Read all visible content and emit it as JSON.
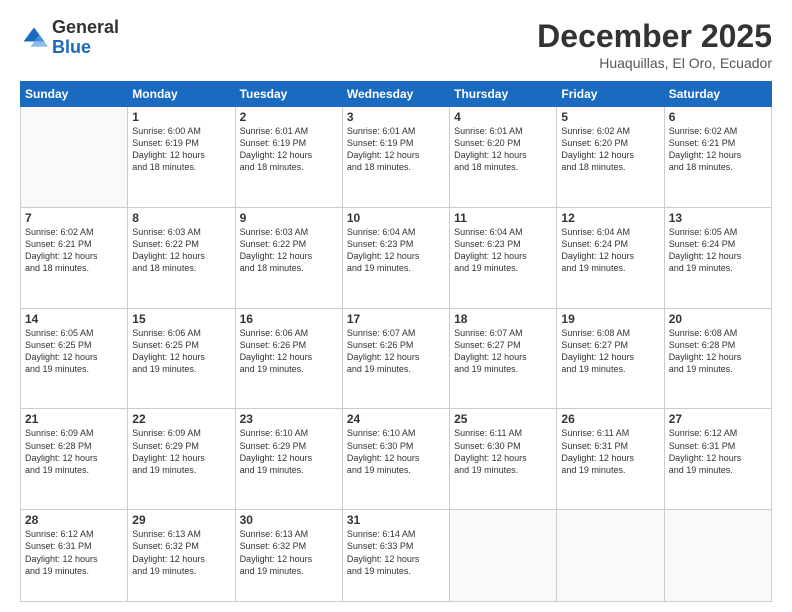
{
  "logo": {
    "general": "General",
    "blue": "Blue"
  },
  "header": {
    "month": "December 2025",
    "location": "Huaquillas, El Oro, Ecuador"
  },
  "weekdays": [
    "Sunday",
    "Monday",
    "Tuesday",
    "Wednesday",
    "Thursday",
    "Friday",
    "Saturday"
  ],
  "weeks": [
    [
      {
        "day": "",
        "info": ""
      },
      {
        "day": "1",
        "info": "Sunrise: 6:00 AM\nSunset: 6:19 PM\nDaylight: 12 hours\nand 18 minutes."
      },
      {
        "day": "2",
        "info": "Sunrise: 6:01 AM\nSunset: 6:19 PM\nDaylight: 12 hours\nand 18 minutes."
      },
      {
        "day": "3",
        "info": "Sunrise: 6:01 AM\nSunset: 6:19 PM\nDaylight: 12 hours\nand 18 minutes."
      },
      {
        "day": "4",
        "info": "Sunrise: 6:01 AM\nSunset: 6:20 PM\nDaylight: 12 hours\nand 18 minutes."
      },
      {
        "day": "5",
        "info": "Sunrise: 6:02 AM\nSunset: 6:20 PM\nDaylight: 12 hours\nand 18 minutes."
      },
      {
        "day": "6",
        "info": "Sunrise: 6:02 AM\nSunset: 6:21 PM\nDaylight: 12 hours\nand 18 minutes."
      }
    ],
    [
      {
        "day": "7",
        "info": "Sunrise: 6:02 AM\nSunset: 6:21 PM\nDaylight: 12 hours\nand 18 minutes."
      },
      {
        "day": "8",
        "info": "Sunrise: 6:03 AM\nSunset: 6:22 PM\nDaylight: 12 hours\nand 18 minutes."
      },
      {
        "day": "9",
        "info": "Sunrise: 6:03 AM\nSunset: 6:22 PM\nDaylight: 12 hours\nand 18 minutes."
      },
      {
        "day": "10",
        "info": "Sunrise: 6:04 AM\nSunset: 6:23 PM\nDaylight: 12 hours\nand 19 minutes."
      },
      {
        "day": "11",
        "info": "Sunrise: 6:04 AM\nSunset: 6:23 PM\nDaylight: 12 hours\nand 19 minutes."
      },
      {
        "day": "12",
        "info": "Sunrise: 6:04 AM\nSunset: 6:24 PM\nDaylight: 12 hours\nand 19 minutes."
      },
      {
        "day": "13",
        "info": "Sunrise: 6:05 AM\nSunset: 6:24 PM\nDaylight: 12 hours\nand 19 minutes."
      }
    ],
    [
      {
        "day": "14",
        "info": "Sunrise: 6:05 AM\nSunset: 6:25 PM\nDaylight: 12 hours\nand 19 minutes."
      },
      {
        "day": "15",
        "info": "Sunrise: 6:06 AM\nSunset: 6:25 PM\nDaylight: 12 hours\nand 19 minutes."
      },
      {
        "day": "16",
        "info": "Sunrise: 6:06 AM\nSunset: 6:26 PM\nDaylight: 12 hours\nand 19 minutes."
      },
      {
        "day": "17",
        "info": "Sunrise: 6:07 AM\nSunset: 6:26 PM\nDaylight: 12 hours\nand 19 minutes."
      },
      {
        "day": "18",
        "info": "Sunrise: 6:07 AM\nSunset: 6:27 PM\nDaylight: 12 hours\nand 19 minutes."
      },
      {
        "day": "19",
        "info": "Sunrise: 6:08 AM\nSunset: 6:27 PM\nDaylight: 12 hours\nand 19 minutes."
      },
      {
        "day": "20",
        "info": "Sunrise: 6:08 AM\nSunset: 6:28 PM\nDaylight: 12 hours\nand 19 minutes."
      }
    ],
    [
      {
        "day": "21",
        "info": "Sunrise: 6:09 AM\nSunset: 6:28 PM\nDaylight: 12 hours\nand 19 minutes."
      },
      {
        "day": "22",
        "info": "Sunrise: 6:09 AM\nSunset: 6:29 PM\nDaylight: 12 hours\nand 19 minutes."
      },
      {
        "day": "23",
        "info": "Sunrise: 6:10 AM\nSunset: 6:29 PM\nDaylight: 12 hours\nand 19 minutes."
      },
      {
        "day": "24",
        "info": "Sunrise: 6:10 AM\nSunset: 6:30 PM\nDaylight: 12 hours\nand 19 minutes."
      },
      {
        "day": "25",
        "info": "Sunrise: 6:11 AM\nSunset: 6:30 PM\nDaylight: 12 hours\nand 19 minutes."
      },
      {
        "day": "26",
        "info": "Sunrise: 6:11 AM\nSunset: 6:31 PM\nDaylight: 12 hours\nand 19 minutes."
      },
      {
        "day": "27",
        "info": "Sunrise: 6:12 AM\nSunset: 6:31 PM\nDaylight: 12 hours\nand 19 minutes."
      }
    ],
    [
      {
        "day": "28",
        "info": "Sunrise: 6:12 AM\nSunset: 6:31 PM\nDaylight: 12 hours\nand 19 minutes."
      },
      {
        "day": "29",
        "info": "Sunrise: 6:13 AM\nSunset: 6:32 PM\nDaylight: 12 hours\nand 19 minutes."
      },
      {
        "day": "30",
        "info": "Sunrise: 6:13 AM\nSunset: 6:32 PM\nDaylight: 12 hours\nand 19 minutes."
      },
      {
        "day": "31",
        "info": "Sunrise: 6:14 AM\nSunset: 6:33 PM\nDaylight: 12 hours\nand 19 minutes."
      },
      {
        "day": "",
        "info": ""
      },
      {
        "day": "",
        "info": ""
      },
      {
        "day": "",
        "info": ""
      }
    ]
  ]
}
